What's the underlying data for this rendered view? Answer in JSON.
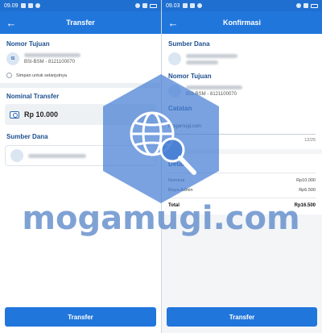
{
  "left": {
    "status": {
      "time": "09.09"
    },
    "appbar": {
      "title": "Transfer"
    },
    "recipient": {
      "section_title": "Nomor Tujuan",
      "avatar_initials": "IS",
      "bank_line": "BSI-BSM - 8121100070",
      "save_label": "Simpan untuk selanjutnya"
    },
    "amount": {
      "section_title": "Nominal Transfer",
      "value": "Rp 10.000"
    },
    "source": {
      "section_title": "Sumber Dana"
    },
    "button_label": "Transfer"
  },
  "right": {
    "status": {
      "time": "09.03"
    },
    "appbar": {
      "title": "Konfirmasi"
    },
    "source": {
      "section_title": "Sumber Dana"
    },
    "recipient": {
      "section_title": "Nomor Tujuan",
      "bank_line": "BSI-BSM - 8121100070"
    },
    "note": {
      "section_title": "Catatan",
      "value": "mogamugi.com",
      "counter": "12/25"
    },
    "detail": {
      "section_title": "Detail",
      "rows": [
        {
          "label": "Nominal",
          "value": "Rp10.000"
        },
        {
          "label": "Biaya Admin",
          "value": "Rp6.500"
        }
      ],
      "total_label": "Total",
      "total_value": "Rp16.500"
    },
    "button_label": "Transfer"
  },
  "watermark": {
    "text": "mogamugi.com"
  },
  "colors": {
    "primary": "#2176dc",
    "section_title": "#1d4f8f",
    "watermark": "#5b88c9"
  }
}
